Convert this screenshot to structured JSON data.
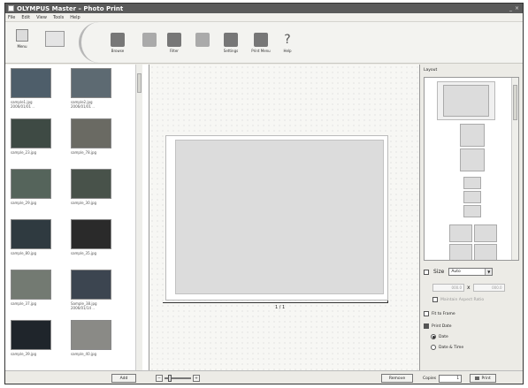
{
  "window": {
    "title": "OLYMPUS Master – Photo Print"
  },
  "menu": {
    "items": [
      "File",
      "Edit",
      "View",
      "Tools",
      "Help"
    ]
  },
  "toolbar": {
    "menu_label": "Menu",
    "buttons": [
      {
        "label": "Browse",
        "icon": "browse-icon"
      },
      {
        "label": "",
        "icon": "rotate-icon"
      },
      {
        "label": "Filter",
        "icon": "filter-icon"
      },
      {
        "label": "",
        "icon": "correction-icon"
      },
      {
        "label": "Settings",
        "icon": "settings-icon"
      },
      {
        "label": "Print Menu",
        "icon": "print-menu-icon"
      },
      {
        "label": "Help",
        "icon": "help-icon"
      }
    ]
  },
  "thumbnails": [
    {
      "caption": "sample1.jpg",
      "caption2": "2006/01/01 ..",
      "color": "#4e5e6a"
    },
    {
      "caption": "sample2.jpg",
      "caption2": "2006/01/01 ..",
      "color": "#5d6a72"
    },
    {
      "caption": "sample_23.jpg",
      "caption2": "",
      "color": "#3e4a44"
    },
    {
      "caption": "sample_78.jpg",
      "caption2": "",
      "color": "#6a6a63"
    },
    {
      "caption": "sample_29.jpg",
      "caption2": "",
      "color": "#55645b"
    },
    {
      "caption": "sample_30.jpg",
      "caption2": "",
      "color": "#48524a"
    },
    {
      "caption": "sample_80.jpg",
      "caption2": "",
      "color": "#2f3a40"
    },
    {
      "caption": "sample_35.jpg",
      "caption2": "",
      "color": "#2a2a2a"
    },
    {
      "caption": "sample_37.jpg",
      "caption2": "",
      "color": "#737a72"
    },
    {
      "caption": "Sample_38.jpg",
      "caption2": "2006/01/14 ..",
      "color": "#3c4550"
    },
    {
      "caption": "sample_39.jpg",
      "caption2": "",
      "color": "#1f252b"
    },
    {
      "caption": "sample_40.jpg",
      "caption2": "",
      "color": "#8a8a86"
    }
  ],
  "left_pane": {
    "add_label": "Add"
  },
  "preview": {
    "page_indicator": "1 / 1",
    "zoom_minus": "−",
    "zoom_plus": "+"
  },
  "right_panel": {
    "layout_label": "Layout",
    "size_label": "Size",
    "size_value": "Auto",
    "dim_w": "000.0",
    "dim_h": "000.0",
    "dim_sep": "x",
    "maintain_label": "Maintain Aspect Ratio",
    "fit_label": "Fit to Frame",
    "print_date_label": "Print Date",
    "date_option": "Date",
    "date_time_option": "Date & Time",
    "copies_label": "Copies",
    "copies_value": "1",
    "print_button": "Print",
    "remove_button": "Remove"
  }
}
